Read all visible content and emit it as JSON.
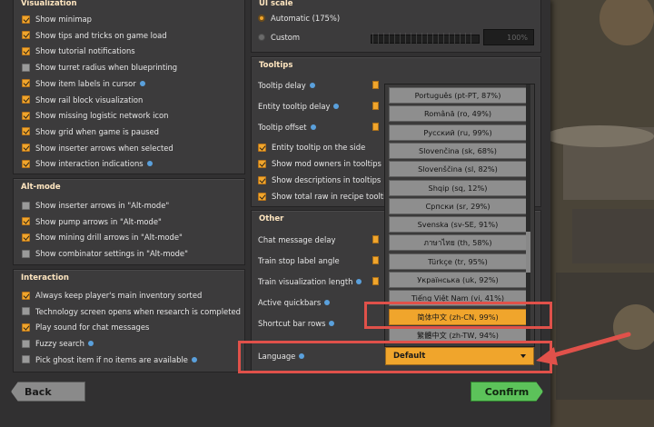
{
  "visualization": {
    "title": "Visualization",
    "items": [
      {
        "label": "Show minimap",
        "checked": true,
        "info": false
      },
      {
        "label": "Show tips and tricks on game load",
        "checked": true,
        "info": false
      },
      {
        "label": "Show tutorial notifications",
        "checked": true,
        "info": false
      },
      {
        "label": "Show turret radius when blueprinting",
        "checked": false,
        "info": false
      },
      {
        "label": "Show item labels in cursor",
        "checked": true,
        "info": true
      },
      {
        "label": "Show rail block visualization",
        "checked": true,
        "info": false
      },
      {
        "label": "Show missing logistic network icon",
        "checked": true,
        "info": false
      },
      {
        "label": "Show grid when game is paused",
        "checked": true,
        "info": false
      },
      {
        "label": "Show inserter arrows when selected",
        "checked": true,
        "info": false
      },
      {
        "label": "Show interaction indications",
        "checked": true,
        "info": true
      }
    ]
  },
  "alt_mode": {
    "title": "Alt-mode",
    "items": [
      {
        "label": "Show inserter arrows in \"Alt-mode\"",
        "checked": false,
        "info": false
      },
      {
        "label": "Show pump arrows in \"Alt-mode\"",
        "checked": true,
        "info": false
      },
      {
        "label": "Show mining drill arrows in \"Alt-mode\"",
        "checked": true,
        "info": false
      },
      {
        "label": "Show combinator settings in \"Alt-mode\"",
        "checked": false,
        "info": false
      }
    ]
  },
  "interaction": {
    "title": "Interaction",
    "items": [
      {
        "label": "Always keep player's main inventory sorted",
        "checked": true,
        "info": false
      },
      {
        "label": "Technology screen opens when research is completed",
        "checked": false,
        "info": false
      },
      {
        "label": "Play sound for chat messages",
        "checked": true,
        "info": false
      },
      {
        "label": "Fuzzy search",
        "checked": false,
        "info": true
      },
      {
        "label": "Pick ghost item if no items are available",
        "checked": false,
        "info": true
      }
    ]
  },
  "ui_scale": {
    "title": "UI scale",
    "automatic_label": "Automatic (175%)",
    "custom_label": "Custom",
    "custom_value": "100%",
    "automatic_selected": true
  },
  "tooltips": {
    "title": "Tooltips",
    "tooltip_delay": "Tooltip delay",
    "entity_tooltip_delay": "Entity tooltip delay",
    "tooltip_offset": "Tooltip offset",
    "checks": [
      {
        "label": "Entity tooltip on the side",
        "checked": true
      },
      {
        "label": "Show mod owners in tooltips",
        "checked": true
      },
      {
        "label": "Show descriptions in tooltips",
        "checked": true
      },
      {
        "label": "Show total raw in recipe tooltips",
        "checked": true
      }
    ]
  },
  "other": {
    "title": "Other",
    "chat_message_delay": "Chat message delay",
    "train_stop_label_angle": "Train stop label angle",
    "train_visualization_length": "Train visualization length",
    "active_quickbars": "Active quickbars",
    "shortcut_bar_rows": "Shortcut bar rows",
    "language_label": "Language",
    "language_value": "Default"
  },
  "language_options": [
    "Português (pt-PT, 87%)",
    "Română (ro, 49%)",
    "Русский (ru, 99%)",
    "Slovenčina (sk, 68%)",
    "Slovenščina (sl, 82%)",
    "Shqip (sq, 12%)",
    "Српски (sr, 29%)",
    "Svenska (sv-SE, 91%)",
    "ภาษาไทย (th, 58%)",
    "Türkçe (tr, 95%)",
    "Українська (uk, 92%)",
    "Tiếng Việt Nam (vi, 41%)",
    "简体中文 (zh-CN, 99%)",
    "繁體中文 (zh-TW, 94%)"
  ],
  "highlighted_language": "简体中文 (zh-CN, 99%)",
  "buttons": {
    "back": "Back",
    "confirm": "Confirm"
  },
  "colors": {
    "accent": "#f0a52c",
    "confirm": "#5cc25a",
    "annotation": "#e0514a",
    "info": "#5aa0dc"
  }
}
